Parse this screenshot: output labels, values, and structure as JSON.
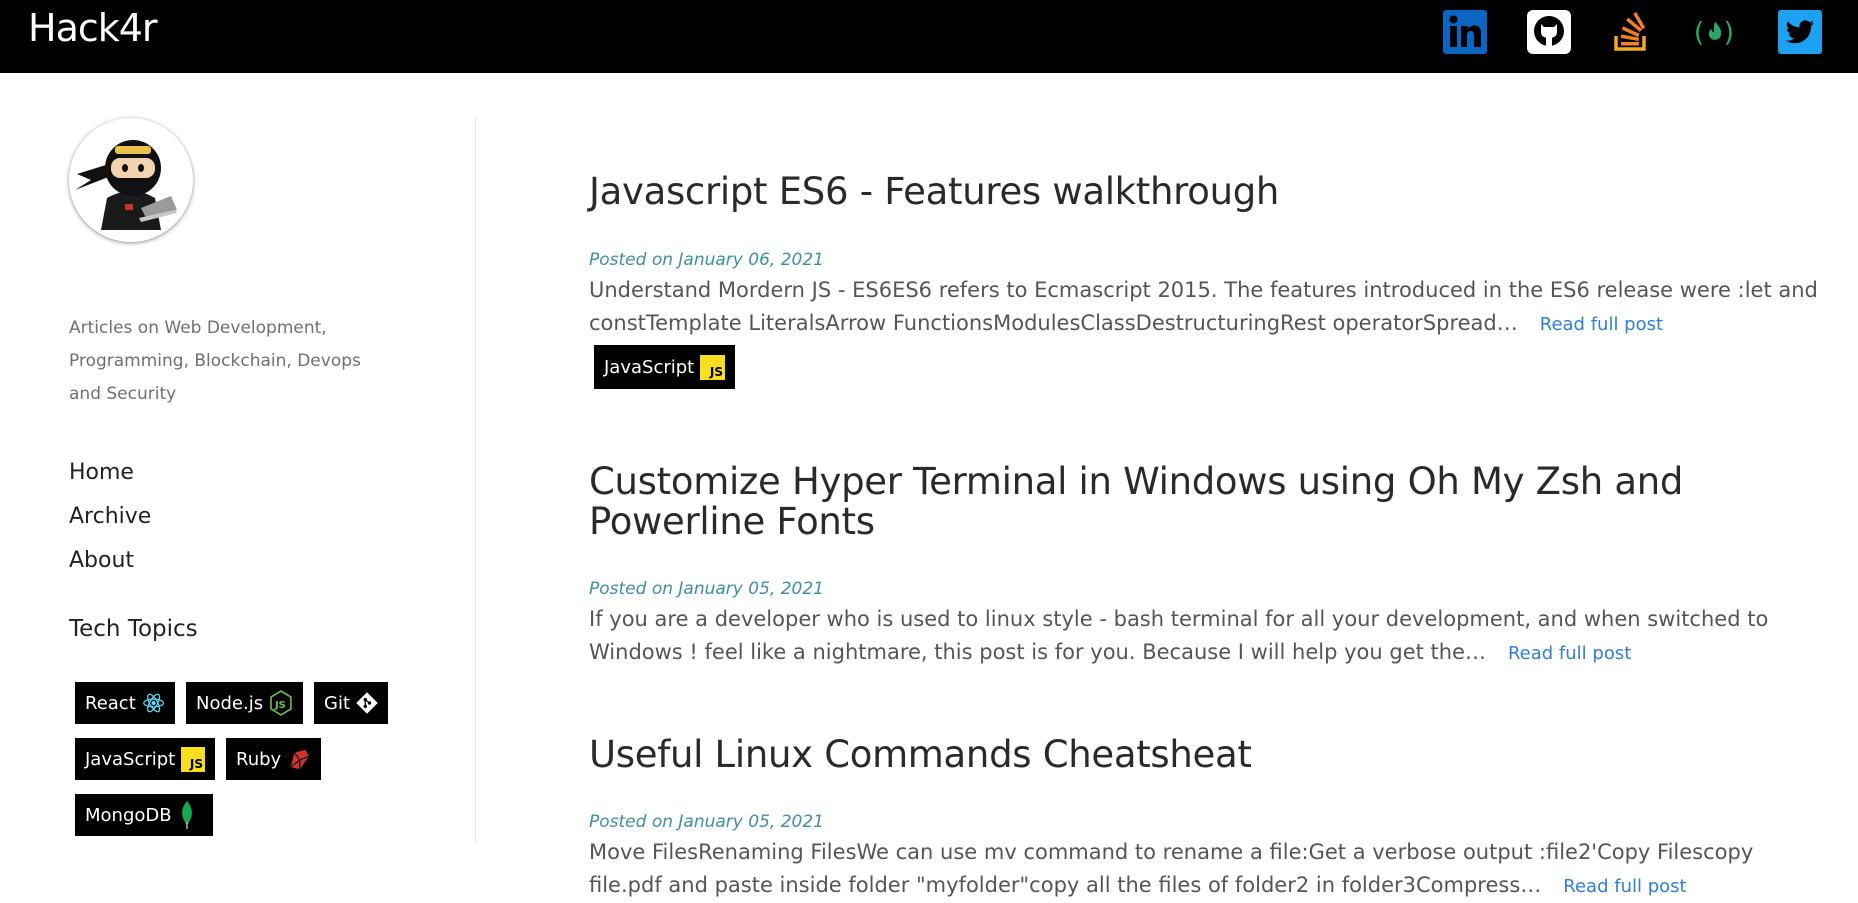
{
  "header": {
    "brand": "Hack4r",
    "social": [
      {
        "icon": "linkedin-icon",
        "color": "#0a66c2"
      },
      {
        "icon": "github-icon",
        "color": "#000000"
      },
      {
        "icon": "stackoverflow-icon",
        "color": "#f48024"
      },
      {
        "icon": "freecodecamp-icon",
        "color": "#2aa66a"
      },
      {
        "icon": "twitter-icon",
        "color": "#1da1f2"
      }
    ]
  },
  "sidebar": {
    "tagline": "Articles on Web Development, Programming, Blockchain, Devops and Security",
    "nav": [
      "Home",
      "Archive",
      "About"
    ],
    "topics_title": "Tech Topics",
    "topics": [
      "React",
      "Node.js",
      "Git",
      "JavaScript",
      "Ruby",
      "MongoDB"
    ]
  },
  "posts": [
    {
      "title": "Javascript ES6 - Features walkthrough",
      "date": "Posted on January 06, 2021",
      "excerpt": "Understand Mordern JS - ES6ES6 refers to Ecmascript 2015. The features introduced in the ES6 release were :let and constTemplate LiteralsArrow FunctionsModulesClassDestructuringRest operatorSpread…",
      "read_more": "Read full post",
      "tag": "JavaScript"
    },
    {
      "title": "Customize Hyper Terminal in Windows using Oh My Zsh and Powerline Fonts",
      "date": "Posted on January 05, 2021",
      "excerpt": "If you are a developer who is used to linux style - bash terminal for all your development, and when switched to Windows ! feel like a nightmare, this post is for you. Because I will help you get the…",
      "read_more": "Read full post"
    },
    {
      "title": "Useful Linux Commands Cheatsheat",
      "date": "Posted on January 05, 2021",
      "excerpt": "Move FilesRenaming FilesWe can use mv command to rename a file:Get a verbose output :file2'Copy Filescopy file.pdf and paste inside folder \"myfolder\"copy all the files of folder2 in folder3Compress…",
      "read_more": "Read full post"
    }
  ]
}
